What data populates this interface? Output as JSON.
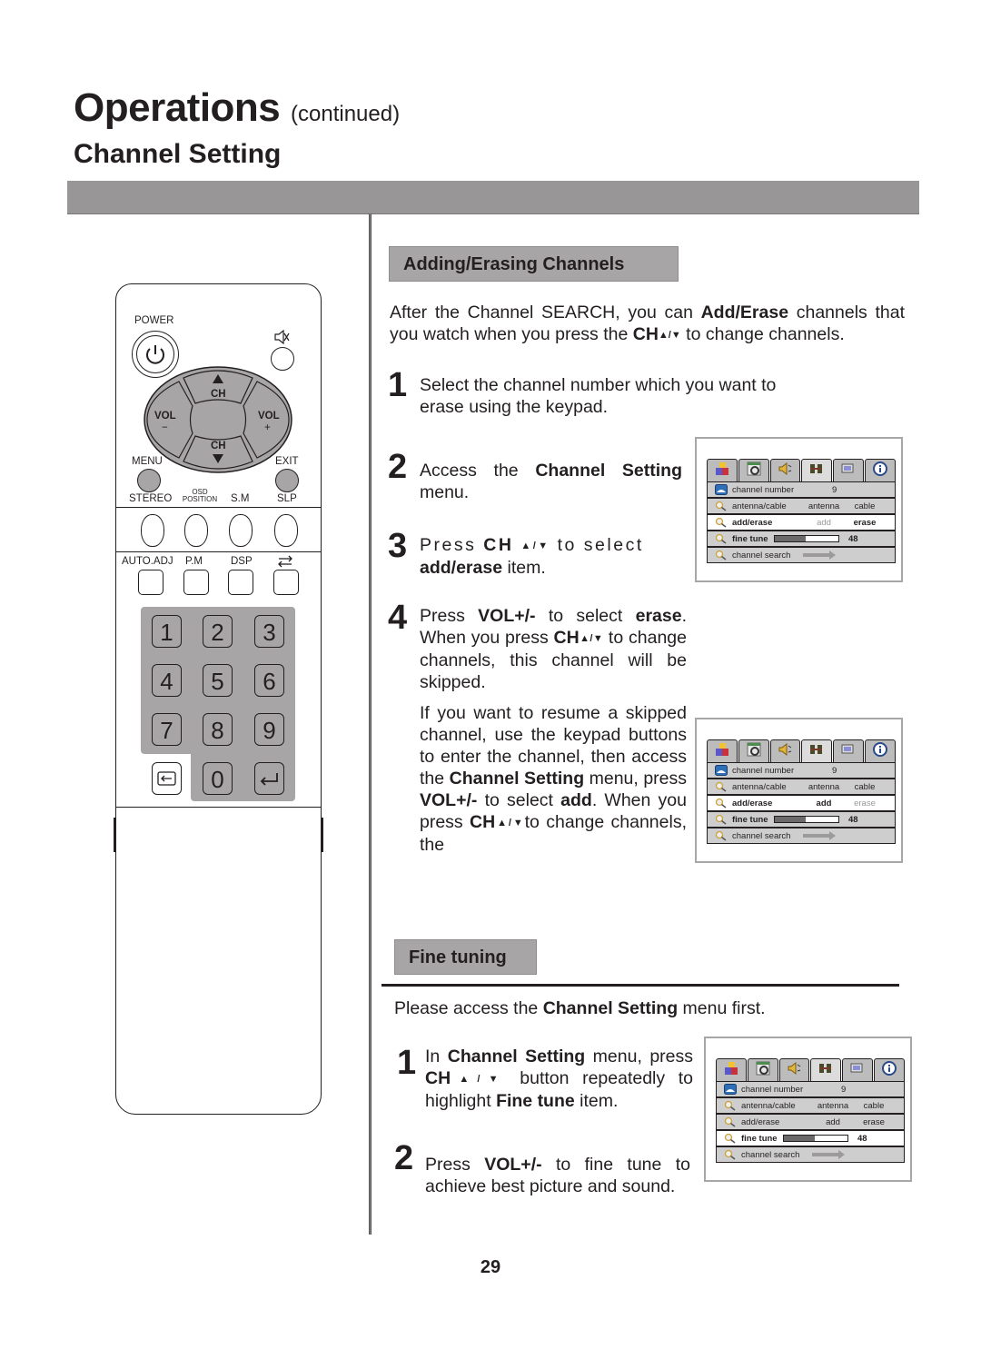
{
  "header": {
    "title": "Operations",
    "title_suffix": "(continued)",
    "subtitle": "Channel Setting"
  },
  "remote": {
    "power_label": "POWER",
    "mute_icon": "mute-icon",
    "dpad": {
      "ch_up": "CH",
      "ch_down": "CH",
      "vol_minus": "VOL",
      "vol_minus_sign": "−",
      "vol_plus": "VOL",
      "vol_plus_sign": "+"
    },
    "menu_label": "MENU",
    "exit_label": "EXIT",
    "row1_labels": [
      "STEREO",
      "OSD",
      "POSITION",
      "S.M",
      "SLP"
    ],
    "row2_labels": [
      "AUTO.ADJ",
      "P.M",
      "DSP"
    ],
    "swap_icon": "swap-icon",
    "keys": [
      "1",
      "2",
      "3",
      "4",
      "5",
      "6",
      "7",
      "8",
      "9",
      "0"
    ],
    "input_icon": "input-source-icon",
    "enter_icon": "enter-icon"
  },
  "adding": {
    "heading": "Adding/Erasing Channels",
    "intro_pre": "After the Channel SEARCH, you can ",
    "intro_bold": "Add/Erase",
    "intro_mid": " channels that you watch when you press the ",
    "ch": "CH",
    "arrows": "▲/▼",
    "intro_post": " to change channels.",
    "steps": [
      {
        "num": "1",
        "text": "Select the channel number which you want to erase using the keypad."
      },
      {
        "num": "2",
        "pre": "Access the ",
        "bold": "Channel Setting",
        "post": " menu."
      },
      {
        "num": "3",
        "pre": "Press ",
        "post": "to select",
        "bold2": "add/erase",
        "post2": " item."
      },
      {
        "num": "4",
        "pre": "Press ",
        "bold": "VOL+/-",
        "mid": " to select ",
        "bold2": "erase",
        "mid2": ". When you press ",
        "post": " to change channels, this channel will be skipped."
      }
    ],
    "resume": {
      "t1": "If you want to resume a skipped channel, use the keypad buttons to enter the channel, then access the ",
      "b1": "Channel Setting",
      "t2": " menu, press ",
      "b2": "VOL+/-",
      "t3": " to select ",
      "b3": "add",
      "t4": ". When you press ",
      "t5": "to change channels, the"
    }
  },
  "fine": {
    "heading": "Fine tuning",
    "intro_pre": "Please access the ",
    "intro_bold": "Channel Setting",
    "intro_post": " menu first.",
    "steps": [
      {
        "num": "1",
        "pre": "In ",
        "bold": "Channel Setting",
        "mid": " menu, press ",
        "mid2": " button repeatedly to highlight ",
        "bold2": "Fine tune",
        "post": " item."
      },
      {
        "num": "2",
        "pre": "Press ",
        "bold": "VOL+/-",
        "post": "  to fine tune to achieve best picture and sound."
      }
    ]
  },
  "osd_menus": [
    {
      "tabs": [
        "picture-icon",
        "setup-icon",
        "sound-icon",
        "channel-icon",
        "display-icon",
        "info-icon"
      ],
      "active_tab": 3,
      "rows": {
        "channel_number": {
          "label": "channel number",
          "value": "9"
        },
        "antenna_cable": {
          "label": "antenna/cable",
          "opt1": "antenna",
          "opt2": "cable"
        },
        "add_erase": {
          "label": "add/erase",
          "opt1": "add",
          "opt2": "erase",
          "selected": "erase"
        },
        "fine_tune": {
          "label": "fine tune",
          "value": "48",
          "level": 0.48
        },
        "channel_search": {
          "label": "channel search"
        }
      },
      "highlighted": "add_erase"
    },
    {
      "tabs": [
        "picture-icon",
        "setup-icon",
        "sound-icon",
        "channel-icon",
        "display-icon",
        "info-icon"
      ],
      "active_tab": 3,
      "rows": {
        "channel_number": {
          "label": "channel number",
          "value": "9"
        },
        "antenna_cable": {
          "label": "antenna/cable",
          "opt1": "antenna",
          "opt2": "cable"
        },
        "add_erase": {
          "label": "add/erase",
          "opt1": "add",
          "opt2": "erase",
          "selected": "add"
        },
        "fine_tune": {
          "label": "fine tune",
          "value": "48",
          "level": 0.48
        },
        "channel_search": {
          "label": "channel search"
        }
      },
      "highlighted": "add_erase"
    },
    {
      "tabs": [
        "picture-icon",
        "setup-icon",
        "sound-icon",
        "channel-icon",
        "display-icon",
        "info-icon"
      ],
      "active_tab": 3,
      "rows": {
        "channel_number": {
          "label": "channel number",
          "value": "9"
        },
        "antenna_cable": {
          "label": "antenna/cable",
          "opt1": "antenna",
          "opt2": "cable"
        },
        "add_erase": {
          "label": "add/erase",
          "opt1": "add",
          "opt2": "erase",
          "selected": ""
        },
        "fine_tune": {
          "label": "fine tune",
          "value": "48",
          "level": 0.48
        },
        "channel_search": {
          "label": "channel search"
        }
      },
      "highlighted": "fine_tune"
    }
  ],
  "page_number": "29"
}
